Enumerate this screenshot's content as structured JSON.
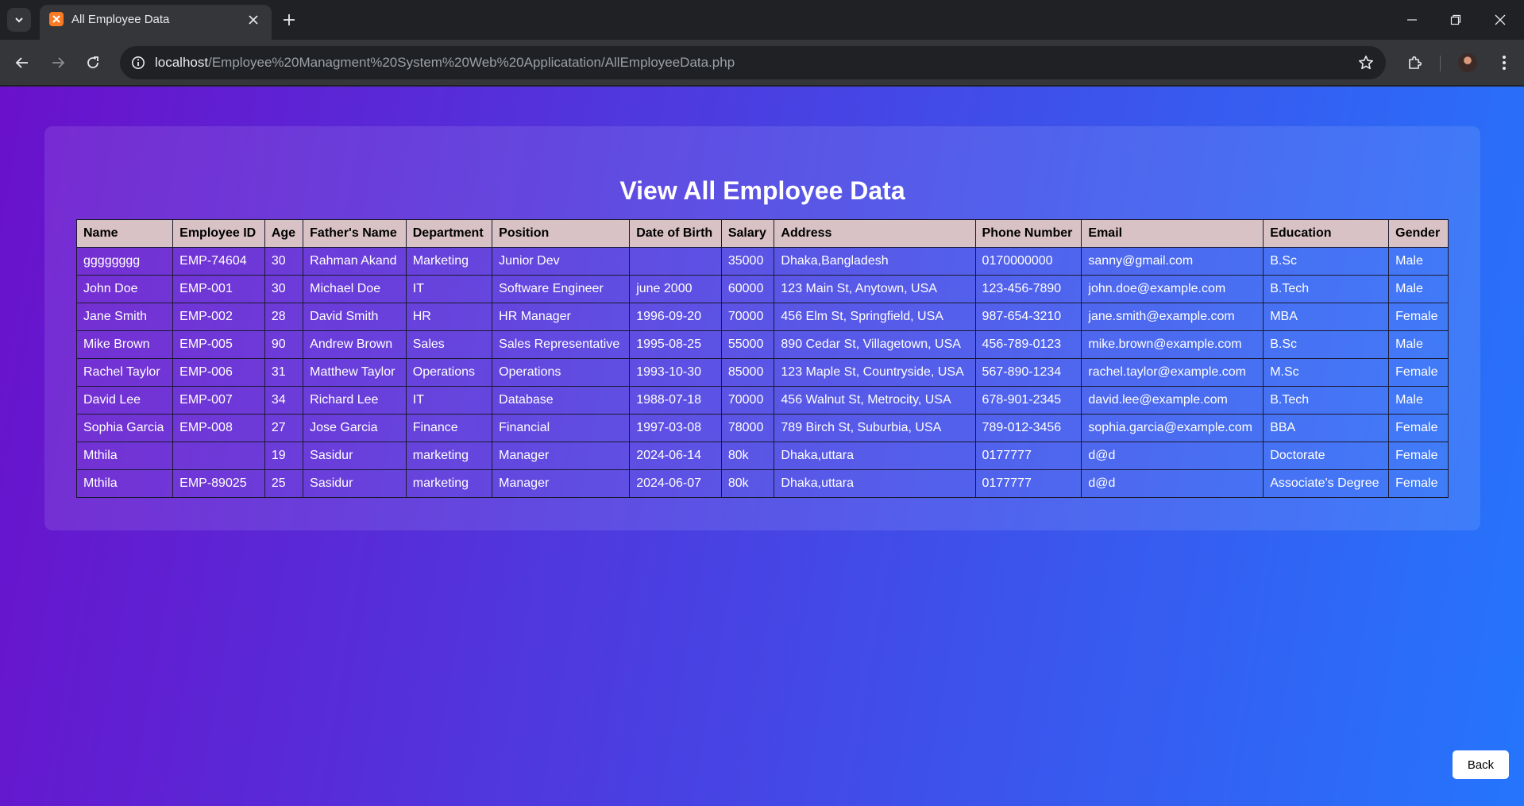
{
  "browser": {
    "tab_title": "All Employee Data",
    "url_host": "localhost",
    "url_path": "/Employee%20Managment%20System%20Web%20Applicatation/AllEmployeeData.php",
    "icons": [
      "tab-search-icon",
      "xampp-favicon-icon",
      "close-icon",
      "plus-icon",
      "minimize-icon",
      "restore-icon",
      "close-window-icon",
      "back-arrow-icon",
      "forward-arrow-icon",
      "reload-icon",
      "site-info-icon",
      "star-icon",
      "extensions-puzzle-icon",
      "more-vert-icon"
    ]
  },
  "page": {
    "title": "View All Employee Data",
    "back_label": "Back",
    "background_colors": [
      "#6a11cb",
      "#2575fc"
    ]
  },
  "table": {
    "headers": [
      "Name",
      "Employee ID",
      "Age",
      "Father's Name",
      "Department",
      "Position",
      "Date of Birth",
      "Salary",
      "Address",
      "Phone Number",
      "Email",
      "Education",
      "Gender"
    ],
    "rows": [
      [
        "gggggggg",
        "EMP-74604",
        "30",
        "Rahman Akand",
        "Marketing",
        "Junior Dev",
        "",
        "35000",
        "Dhaka,Bangladesh",
        "0170000000",
        "sanny@gmail.com",
        "B.Sc",
        "Male"
      ],
      [
        "John Doe",
        "EMP-001",
        "30",
        "Michael Doe",
        "IT",
        "Software Engineer",
        "june 2000",
        "60000",
        "123 Main St, Anytown, USA",
        "123-456-7890",
        "john.doe@example.com",
        "B.Tech",
        "Male"
      ],
      [
        "Jane Smith",
        "EMP-002",
        "28",
        "David Smith",
        "HR",
        "HR Manager",
        "1996-09-20",
        "70000",
        "456 Elm St, Springfield, USA",
        "987-654-3210",
        "jane.smith@example.com",
        "MBA",
        "Female"
      ],
      [
        "Mike Brown",
        "EMP-005",
        "90",
        "Andrew Brown",
        "Sales",
        "Sales Representative",
        "1995-08-25",
        "55000",
        "890 Cedar St, Villagetown, USA",
        "456-789-0123",
        "mike.brown@example.com",
        "B.Sc",
        "Male"
      ],
      [
        "Rachel Taylor",
        "EMP-006",
        "31",
        "Matthew Taylor",
        "Operations",
        "Operations",
        "1993-10-30",
        "85000",
        "123 Maple St, Countryside, USA",
        "567-890-1234",
        "rachel.taylor@example.com",
        "M.Sc",
        "Female"
      ],
      [
        "David Lee",
        "EMP-007",
        "34",
        "Richard Lee",
        "IT",
        "Database",
        "1988-07-18",
        "70000",
        "456 Walnut St, Metrocity, USA",
        "678-901-2345",
        "david.lee@example.com",
        "B.Tech",
        "Male"
      ],
      [
        "Sophia Garcia",
        "EMP-008",
        "27",
        "Jose Garcia",
        "Finance",
        "Financial",
        "1997-03-08",
        "78000",
        "789 Birch St, Suburbia, USA",
        "789-012-3456",
        "sophia.garcia@example.com",
        "BBA",
        "Female"
      ],
      [
        "Mthila",
        "",
        "19",
        "Sasidur",
        "marketing",
        "Manager",
        "2024-06-14",
        "80k",
        "Dhaka,uttara",
        "0177777",
        "d@d",
        "Doctorate",
        "Female"
      ],
      [
        "Mthila",
        "EMP-89025",
        "25",
        "Sasidur",
        "marketing",
        "Manager",
        "2024-06-07",
        "80k",
        "Dhaka,uttara",
        "0177777",
        "d@d",
        "Associate's Degree",
        "Female"
      ]
    ]
  }
}
